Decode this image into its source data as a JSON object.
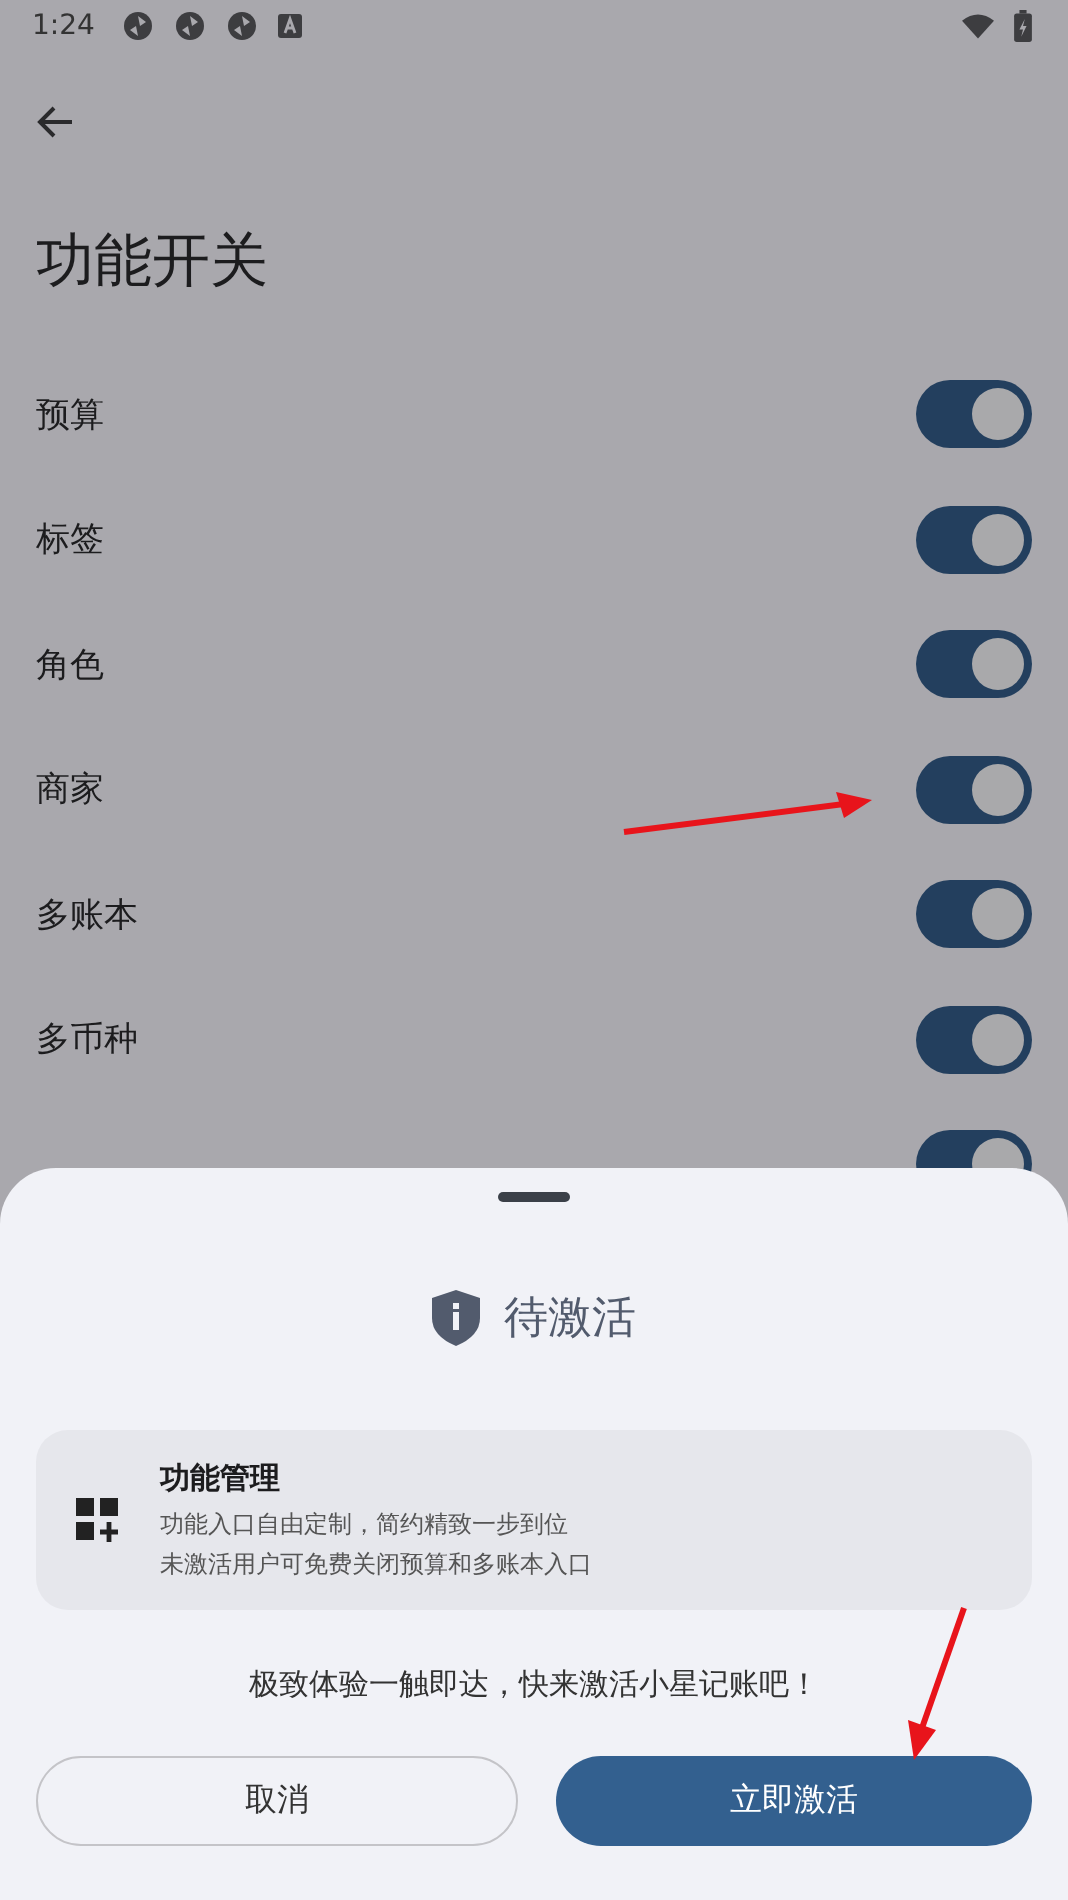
{
  "status_bar": {
    "time": "1:24"
  },
  "title": "功能开关",
  "switches": [
    {
      "label": "预算",
      "on": true
    },
    {
      "label": "标签",
      "on": true
    },
    {
      "label": "角色",
      "on": true
    },
    {
      "label": "商家",
      "on": true
    },
    {
      "label": "多账本",
      "on": true
    },
    {
      "label": "多币种",
      "on": true
    },
    {
      "on": true
    }
  ],
  "sheet": {
    "title": "待激活",
    "card": {
      "title": "功能管理",
      "lines": [
        "功能入口自由定制，简约精致一步到位",
        "未激活用户可免费关闭预算和多账本入口"
      ]
    },
    "message": "极致体验一触即达，快来激活小星记账吧！",
    "buttons": [
      {
        "label": "取消",
        "kind": "outline"
      },
      {
        "label": "立即激活",
        "kind": "primary"
      }
    ]
  }
}
